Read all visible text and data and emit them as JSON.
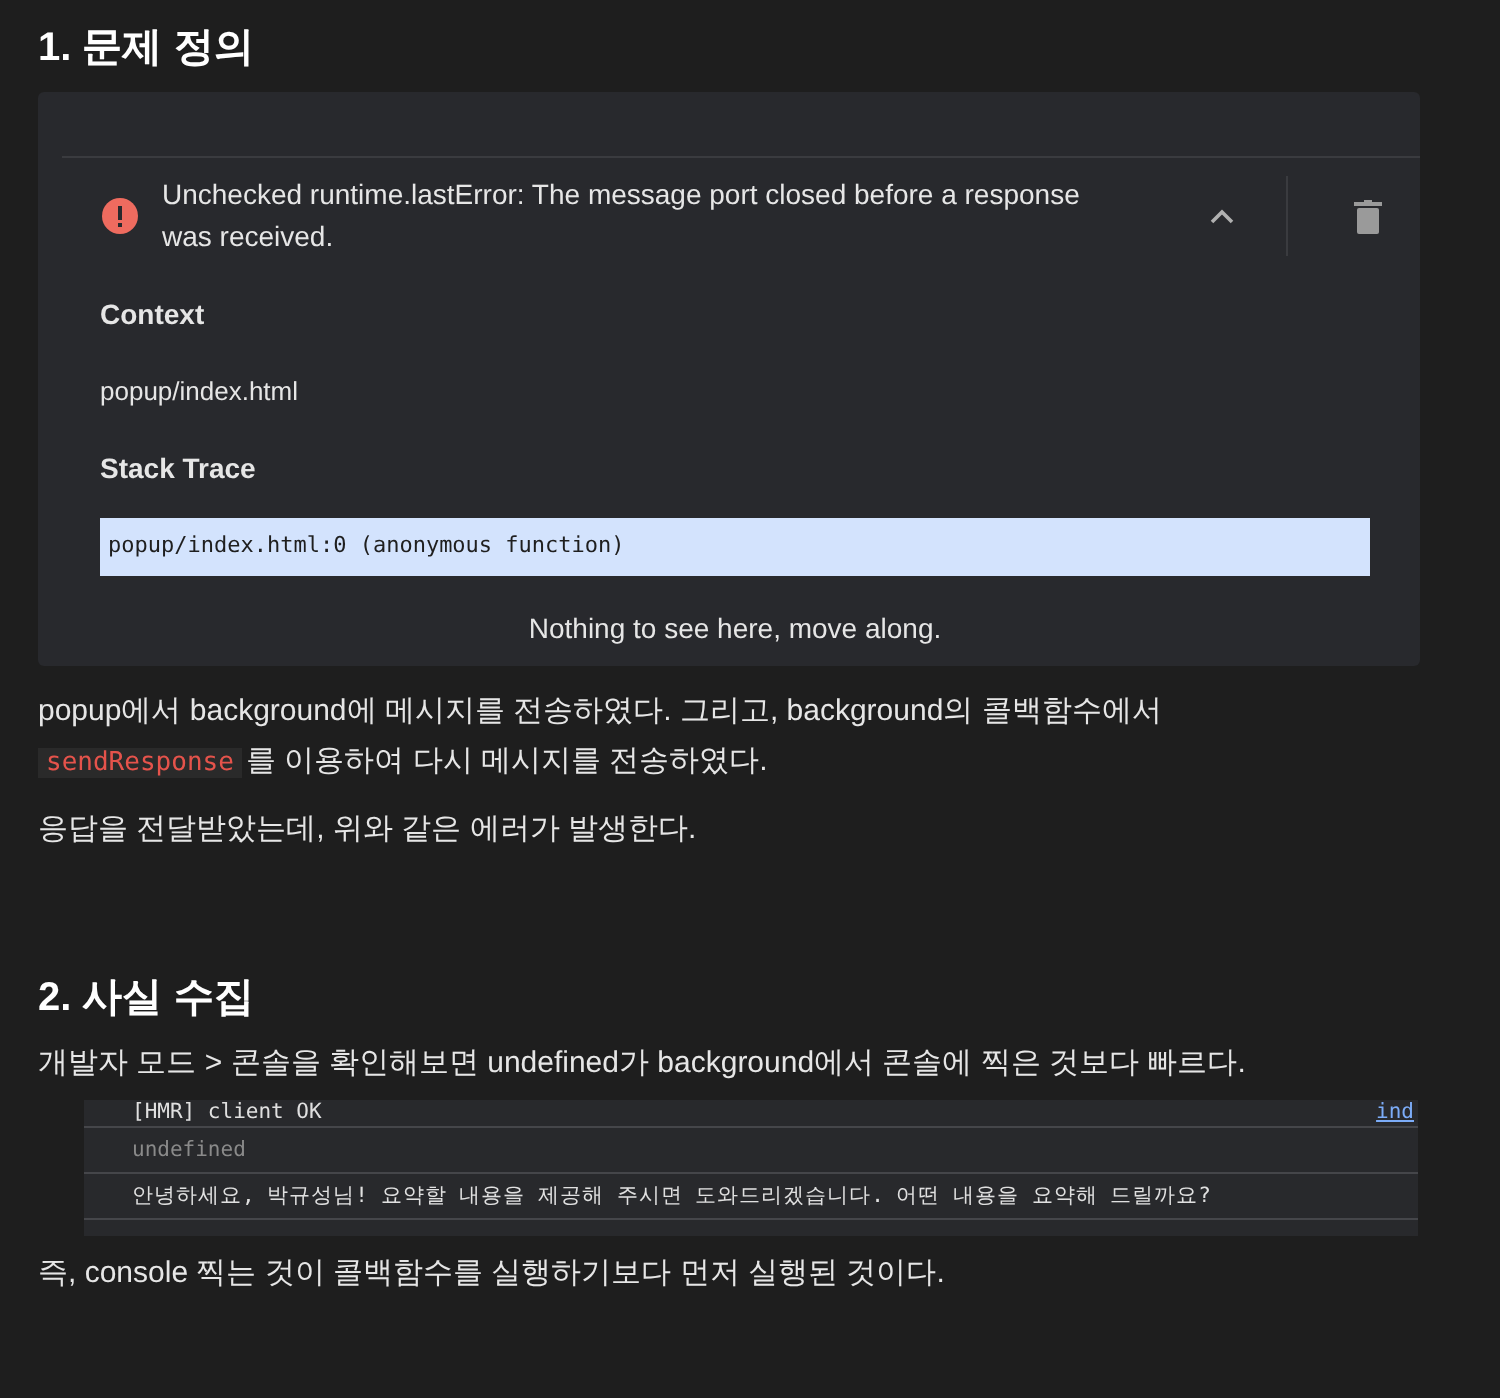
{
  "section_1": {
    "heading": "1. 문제 정의",
    "error_card": {
      "message": "Unchecked runtime.lastError: The message port closed before a response was received.",
      "expanded": true,
      "context_label": "Context",
      "context": "popup/index.html",
      "stack_label": "Stack Trace",
      "stack_line": "popup/index.html:0 (anonymous function)",
      "footer": "Nothing to see here, move along."
    },
    "paragraph_1": {
      "before": "popup에서 background에 메시지를 전송하였다. 그리고, background의 콜백함수에서",
      "code": "sendResponse",
      "after": "를 이용하여 다시 메시지를 전송하였다."
    },
    "paragraph_2": "응답을 전달받았는데, 위와 같은 에러가 발생한다."
  },
  "section_2": {
    "heading": "2. 사실 수집",
    "paragraph_1": "개발자 모드 > 콘솔을 확인해보면 undefined가 background에서 콘솔에 찍은 것보다 빠르다.",
    "console": [
      {
        "kind": "log",
        "text": "[HMR] client OK",
        "link": "ind"
      },
      {
        "kind": "result",
        "text": "undefined"
      },
      {
        "kind": "log",
        "text": "안녕하세요, 박규성님! 요약할 내용을 제공해 주시면 도와드리겠습니다. 어떤 내용을 요약해 드릴까요?"
      }
    ],
    "paragraph_2": "즉, console 찍는 것이 콜백함수를 실행하기보다 먼저 실행된 것이다."
  }
}
